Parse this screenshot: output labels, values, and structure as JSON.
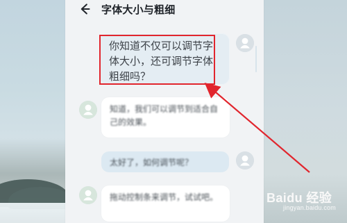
{
  "header": {
    "title": "字体大小与粗细"
  },
  "messages": [
    {
      "side": "right",
      "text": "你知道不仅可以调节字体大小，还可调节字体粗细吗？"
    },
    {
      "side": "left",
      "text": "知道，我们可以调节到适合自己的效果。"
    },
    {
      "side": "right",
      "text": "太好了，如何调节呢？"
    },
    {
      "side": "left",
      "text": "拖动控制条来调节，试试吧。"
    }
  ],
  "watermark": {
    "main": "Baidu 经验",
    "sub": "jingyan.baidu.com"
  },
  "icons": {
    "back": "arrow-left-icon",
    "avatar": "user-avatar-icon"
  },
  "colors": {
    "highlight": "#e1252d",
    "bubble_right": "#e4edf3",
    "bubble_left": "#ffffff",
    "title_text": "#20242a"
  }
}
